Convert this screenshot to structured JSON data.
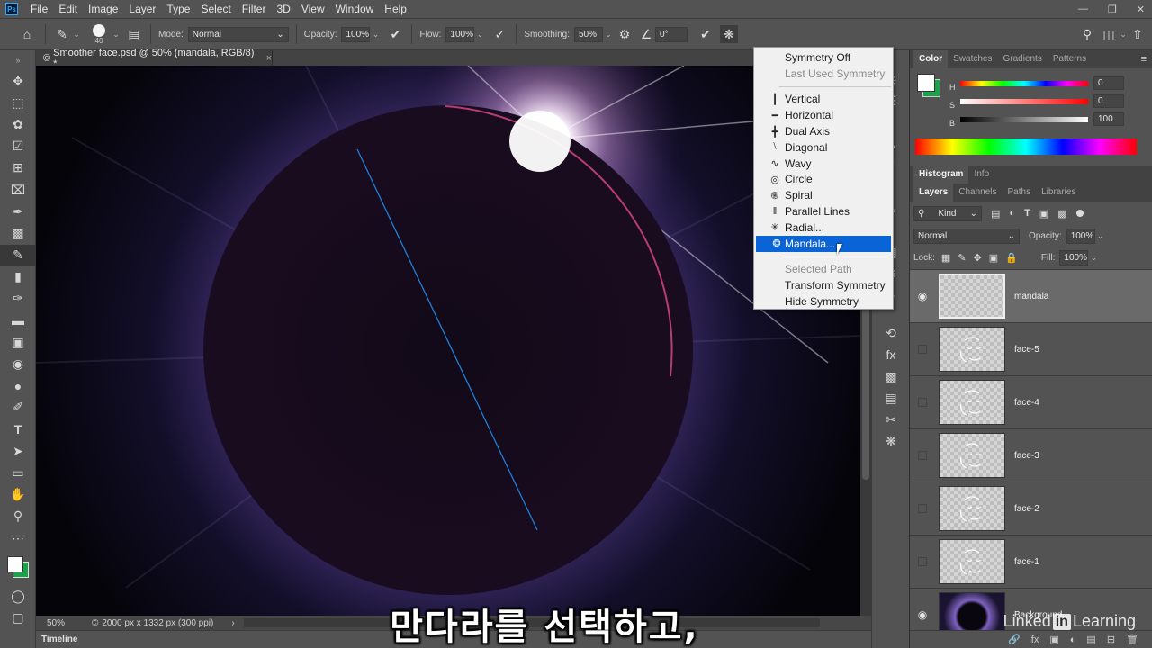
{
  "menubar": {
    "logo": "Ps",
    "items": [
      "File",
      "Edit",
      "Image",
      "Layer",
      "Type",
      "Select",
      "Filter",
      "3D",
      "View",
      "Window",
      "Help"
    ]
  },
  "options": {
    "brush_size": "40",
    "mode_label": "Mode:",
    "mode_value": "Normal",
    "opacity_label": "Opacity:",
    "opacity_value": "100%",
    "flow_label": "Flow:",
    "flow_value": "100%",
    "smoothing_label": "Smoothing:",
    "smoothing_value": "50%",
    "angle_value": "0°"
  },
  "document": {
    "tab_title": "Smoother face.psd @ 50% (mandala, RGB/8) *",
    "zoom": "50%",
    "doc_info": "2000 px x 1332 px (300 ppi)"
  },
  "timeline": {
    "label": "Timeline"
  },
  "symmetry_menu": {
    "items": [
      {
        "label": "Symmetry Off",
        "state": "normal",
        "icon": ""
      },
      {
        "label": "Last Used Symmetry",
        "state": "disabled",
        "icon": ""
      },
      {
        "label": "Vertical",
        "state": "normal",
        "icon": "vertical-icon"
      },
      {
        "label": "Horizontal",
        "state": "normal",
        "icon": "horizontal-icon"
      },
      {
        "label": "Dual Axis",
        "state": "normal",
        "icon": "dual-axis-icon"
      },
      {
        "label": "Diagonal",
        "state": "normal",
        "icon": "diagonal-icon"
      },
      {
        "label": "Wavy",
        "state": "normal",
        "icon": "wavy-icon"
      },
      {
        "label": "Circle",
        "state": "normal",
        "icon": "circle-icon"
      },
      {
        "label": "Spiral",
        "state": "normal",
        "icon": "spiral-icon"
      },
      {
        "label": "Parallel Lines",
        "state": "normal",
        "icon": "parallel-lines-icon"
      },
      {
        "label": "Radial...",
        "state": "normal",
        "icon": "radial-icon"
      },
      {
        "label": "Mandala...",
        "state": "highlighted",
        "icon": "mandala-icon"
      },
      {
        "label": "Selected Path",
        "state": "disabled",
        "icon": ""
      },
      {
        "label": "Transform Symmetry",
        "state": "normal",
        "icon": ""
      },
      {
        "label": "Hide Symmetry",
        "state": "normal",
        "icon": ""
      }
    ]
  },
  "color_panel": {
    "tabs": [
      "Color",
      "Swatches",
      "Gradients",
      "Patterns"
    ],
    "active_tab": "Color",
    "h_label": "H",
    "h_value": "0",
    "s_label": "S",
    "s_value": "0",
    "b_label": "B",
    "b_value": "100",
    "foreground_color": "#ffffff",
    "background_color": "#1aa34a"
  },
  "histogram_panel": {
    "tabs": [
      "Histogram",
      "Info"
    ]
  },
  "layers_panel": {
    "tabs": [
      "Layers",
      "Channels",
      "Paths",
      "Libraries"
    ],
    "filter_kind": "Kind",
    "blend_mode": "Normal",
    "opacity_label": "Opacity:",
    "opacity_value": "100%",
    "lock_label": "Lock:",
    "fill_label": "Fill:",
    "fill_value": "100%",
    "layers": [
      {
        "name": "mandala",
        "visible": true,
        "selected": true
      },
      {
        "name": "face-5",
        "visible": false,
        "selected": false
      },
      {
        "name": "face-4",
        "visible": false,
        "selected": false
      },
      {
        "name": "face-3",
        "visible": false,
        "selected": false
      },
      {
        "name": "face-2",
        "visible": false,
        "selected": false
      },
      {
        "name": "face-1",
        "visible": false,
        "selected": false
      },
      {
        "name": "Background",
        "visible": true,
        "selected": false
      }
    ]
  },
  "subtitle": "만다라를 선택하고,",
  "watermark": {
    "text1": "Linked",
    "text2": "in",
    "text3": " Learning"
  }
}
